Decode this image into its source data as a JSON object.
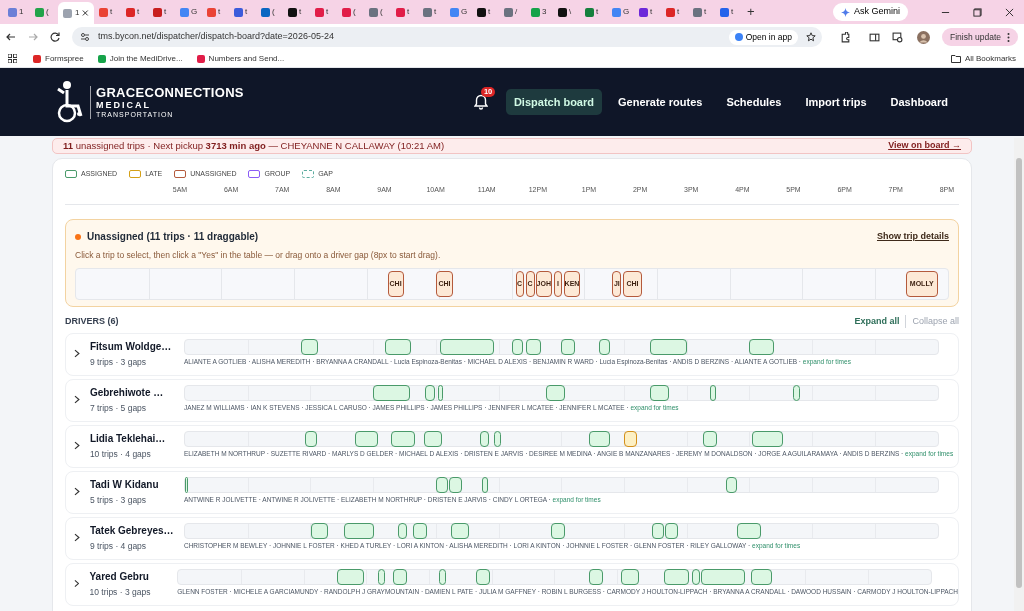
{
  "browser": {
    "tabs": [
      {
        "label": "1",
        "color": "#6b7fd7",
        "selected": false
      },
      {
        "label": "(",
        "color": "#22a34a",
        "selected": false
      },
      {
        "label": "1",
        "color": "#9ca3af",
        "selected": true
      },
      {
        "label": "t",
        "color": "#ea4335",
        "selected": false
      },
      {
        "label": "t",
        "color": "#dc2626",
        "selected": false
      },
      {
        "label": "t",
        "color": "#c81e1e",
        "selected": false
      },
      {
        "label": "G",
        "color": "#4285f4",
        "selected": false
      },
      {
        "label": "t",
        "color": "#ea4335",
        "selected": false
      },
      {
        "label": "t",
        "color": "#3b5bdb",
        "selected": false
      },
      {
        "label": "(",
        "color": "#0a66c2",
        "selected": false
      },
      {
        "label": "t",
        "color": "#111111",
        "selected": false
      },
      {
        "label": "t",
        "color": "#e11d48",
        "selected": false
      },
      {
        "label": "(",
        "color": "#e11d48",
        "selected": false
      },
      {
        "label": "(",
        "color": "#6b7280",
        "selected": false
      },
      {
        "label": "t",
        "color": "#e11d48",
        "selected": false
      },
      {
        "label": "t",
        "color": "#6b7280",
        "selected": false
      },
      {
        "label": "G",
        "color": "#4285f4",
        "selected": false
      },
      {
        "label": "t",
        "color": "#111111",
        "selected": false
      },
      {
        "label": "/",
        "color": "#6b7280",
        "selected": false
      },
      {
        "label": "3",
        "color": "#16a34a",
        "selected": false
      },
      {
        "label": "\\",
        "color": "#111111",
        "selected": false
      },
      {
        "label": "t",
        "color": "#15803d",
        "selected": false
      },
      {
        "label": "G",
        "color": "#4285f4",
        "selected": false
      },
      {
        "label": "t",
        "color": "#6d28d9",
        "selected": false
      },
      {
        "label": "t",
        "color": "#dc2626",
        "selected": false
      },
      {
        "label": "t",
        "color": "#6b7280",
        "selected": false
      },
      {
        "label": "t",
        "color": "#2563eb",
        "selected": false
      }
    ],
    "new_tab": "+",
    "gemini": "Ask Gemini",
    "address": "tms.bycon.net/dispatcher/dispatch-board?date=2026-05-24",
    "open_in_app": "Open in app",
    "finish_update": "Finish update",
    "bookmarks": [
      "Formspree",
      "Join the MediDrive...",
      "Numbers and Send..."
    ],
    "all_bookmarks": "All Bookmarks"
  },
  "header": {
    "logo": [
      "GRACECONNECTIONS",
      "MEDICAL",
      "TRANSPORTATION"
    ],
    "notifications": "10",
    "nav": [
      {
        "label": "Dispatch board",
        "selected": true
      },
      {
        "label": "Generate routes",
        "selected": false
      },
      {
        "label": "Schedules",
        "selected": false
      },
      {
        "label": "Import trips",
        "selected": false
      },
      {
        "label": "Dashboard",
        "selected": false
      }
    ]
  },
  "banner": {
    "text": "**11** unassigned trips · Next pickup **3713 min ago** — CHEYANNE N CALLAWAY (10:21 AM)",
    "link": "View on board →"
  },
  "legend": [
    {
      "label": "ASSIGNED",
      "kind": "solid",
      "color": "#4a9a6a"
    },
    {
      "label": "LATE",
      "kind": "solid",
      "color": "#d4a017"
    },
    {
      "label": "UNASSIGNED",
      "kind": "solid",
      "color": "#b45a3c"
    },
    {
      "label": "GROUP",
      "kind": "solid",
      "color": "#8b5cf6"
    },
    {
      "label": "GAP",
      "kind": "dashed",
      "color": "#5eada0"
    }
  ],
  "hours": [
    "5AM",
    "6AM",
    "7AM",
    "8AM",
    "9AM",
    "10AM",
    "11AM",
    "12PM",
    "1PM",
    "2PM",
    "3PM",
    "4PM",
    "5PM",
    "6PM",
    "7PM",
    "8PM"
  ],
  "unassigned": {
    "title": "Unassigned (11 trips · 11 draggable)",
    "details": "Show trip details",
    "hint": "Click a trip to select, then click a \"Yes\" in the table — or drag onto a driver gap (8px to start drag).",
    "trips": [
      "CHI",
      "CHI",
      "C",
      "C",
      "JOH",
      "I",
      "KEN",
      "JI",
      "CHI",
      "MOLLY"
    ]
  },
  "drivers": {
    "title": "DRIVERS (6)",
    "expand": "Expand all",
    "collapse": "Collapse all",
    "rows": [
      {
        "name": "Fitsum Woldge…",
        "summary": "9 trips · 3 gaps",
        "trips": [
          {
            "kind": "assigned"
          },
          {
            "kind": "assigned"
          },
          {
            "kind": "assigned"
          },
          {
            "kind": "assigned"
          },
          {
            "kind": "assigned"
          },
          {
            "kind": "assigned"
          },
          {
            "kind": "assigned"
          },
          {
            "kind": "assigned"
          },
          {
            "kind": "assigned"
          }
        ],
        "passengers": "ALIANTE A GOTLIEB · ALISHA MEREDITH · BRYANNA A CRANDALL · Lucia Espinoza-Benitas · MICHAEL D ALEXIS · BENJAMIN R WARD · Lucia Espinoza-Benitas · ANDIS D BERZINS · ALIANTE A GOTLIEB ·",
        "expand": "expand for times"
      },
      {
        "name": "Gebrehiwote …",
        "summary": "7 trips · 5 gaps",
        "trips": [
          {
            "kind": "assigned"
          },
          {
            "kind": "assigned"
          },
          {
            "kind": "assigned"
          },
          {
            "kind": "assigned"
          },
          {
            "kind": "assigned"
          },
          {
            "kind": "assigned"
          },
          {
            "kind": "assigned"
          }
        ],
        "passengers": "JANEZ M WILLIAMS · IAN K STEVENS · JESSICA L CARUSO · JAMES PHILLIPS · JAMES PHILLIPS · JENNIFER L MCATEE · JENNIFER L MCATEE ·",
        "expand": "expand for times"
      },
      {
        "name": "Lidia Teklehai…",
        "summary": "10 trips · 4 gaps",
        "trips": [
          {
            "kind": "assigned"
          },
          {
            "kind": "assigned"
          },
          {
            "kind": "assigned"
          },
          {
            "kind": "assigned"
          },
          {
            "kind": "assigned"
          },
          {
            "kind": "assigned"
          },
          {
            "kind": "assigned"
          },
          {
            "kind": "late"
          },
          {
            "kind": "assigned"
          },
          {
            "kind": "assigned"
          }
        ],
        "passengers": "ELIZABETH M NORTHRUP · SUZETTE RIVARD · MARLYS D GELDER · MICHAEL D ALEXIS · DRISTEN E JARVIS · DESIREE M MEDINA · ANGIE B MANZANARES · JEREMY M DONALDSON · JORGE A AGUILARAMAYA · ANDIS D BERZINS ·",
        "expand": "expand for times"
      },
      {
        "name": "Tadi W Kidanu",
        "summary": "5 trips · 3 gaps",
        "trips": [
          {
            "kind": "assigned"
          },
          {
            "kind": "assigned"
          },
          {
            "kind": "assigned"
          },
          {
            "kind": "assigned"
          },
          {
            "kind": "assigned"
          }
        ],
        "passengers": "ANTWINE R JOLIVETTE · ANTWINE R JOLIVETTE · ELIZABETH M NORTHRUP · DRISTEN E JARVIS · CINDY L ORTEGA ·",
        "expand": "expand for times"
      },
      {
        "name": "Tatek Gebreyes…",
        "summary": "9 trips · 4 gaps",
        "trips": [
          {
            "kind": "assigned"
          },
          {
            "kind": "assigned"
          },
          {
            "kind": "assigned"
          },
          {
            "kind": "assigned"
          },
          {
            "kind": "assigned"
          },
          {
            "kind": "assigned"
          },
          {
            "kind": "assigned"
          },
          {
            "kind": "assigned"
          },
          {
            "kind": "assigned"
          }
        ],
        "passengers": "CHRISTOPHER M BEWLEY · JOHNNIE L FOSTER · KHED A TURLEY · LORI A KINTON · ALISHA MEREDITH · LORI A KINTON · JOHNNIE L FOSTER · GLENN FOSTER · RILEY GALLOWAY ·",
        "expand": "expand for times"
      },
      {
        "name": "Yared Gebru",
        "summary": "10 trips · 3 gaps",
        "trips": [
          {
            "kind": "assigned"
          },
          {
            "kind": "assigned"
          },
          {
            "kind": "assigned"
          },
          {
            "kind": "assigned"
          },
          {
            "kind": "assigned"
          },
          {
            "kind": "assigned"
          },
          {
            "kind": "assigned"
          },
          {
            "kind": "assigned"
          },
          {
            "kind": "assigned"
          },
          {
            "kind": "assigned"
          },
          {
            "kind": "assigned"
          }
        ],
        "passengers": "GLENN FOSTER · MICHELE A GARCIAMUNDY · RANDOLPH J GRAYMOUNTAIN · DAMIEN L PATE · JULIA M GAFFNEY · ROBIN L BURGESS · CARMODY J HOULTON-LIPPACH · BRYANNA A CRANDALL · DAWOOD HUSSAIN · CARMODY J HOULTON-LIPPACH"
      }
    ]
  }
}
